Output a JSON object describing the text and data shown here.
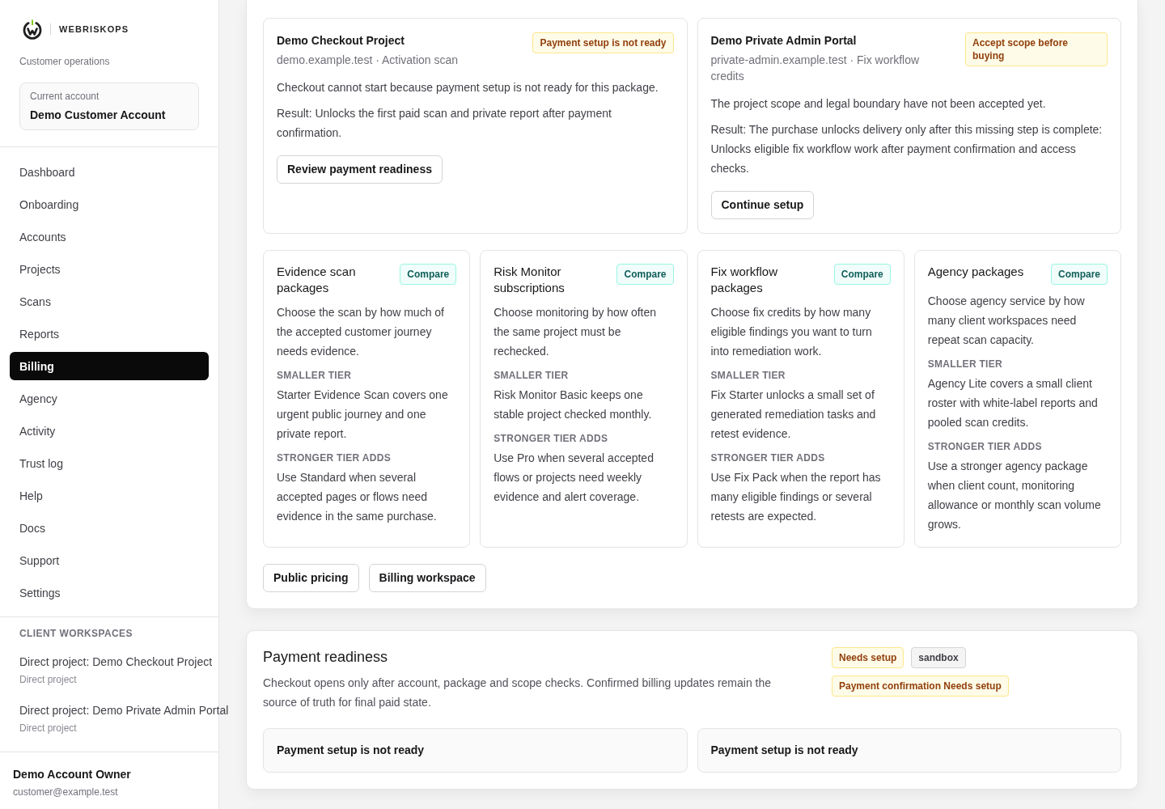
{
  "sidebar": {
    "brand": "WEBRISKOPS",
    "subtitle": "Customer operations",
    "account": {
      "label": "Current account",
      "name": "Demo Customer Account"
    },
    "nav": [
      {
        "label": "Dashboard",
        "selected": false
      },
      {
        "label": "Onboarding",
        "selected": false
      },
      {
        "label": "Accounts",
        "selected": false
      },
      {
        "label": "Projects",
        "selected": false
      },
      {
        "label": "Scans",
        "selected": false
      },
      {
        "label": "Reports",
        "selected": false
      },
      {
        "label": "Billing",
        "selected": true
      },
      {
        "label": "Agency",
        "selected": false
      },
      {
        "label": "Activity",
        "selected": false
      },
      {
        "label": "Trust log",
        "selected": false
      },
      {
        "label": "Help",
        "selected": false
      },
      {
        "label": "Docs",
        "selected": false
      },
      {
        "label": "Support",
        "selected": false
      },
      {
        "label": "Settings",
        "selected": false
      }
    ],
    "workspaces": {
      "heading": "CLIENT WORKSPACES",
      "items": [
        {
          "title": "Direct project: Demo Checkout Project",
          "subtitle": "Direct project"
        },
        {
          "title": "Direct project: Demo Private Admin Portal",
          "subtitle": "Direct project"
        }
      ]
    },
    "user": {
      "name": "Demo Account Owner",
      "email": "customer@example.test"
    }
  },
  "project_purchases": {
    "projects": [
      {
        "title": "Demo Checkout Project",
        "badge": {
          "label": "Payment setup is not ready",
          "kind": "warning"
        },
        "meta": "demo.example.test · Activation scan",
        "description": "Checkout cannot start because payment setup is not ready for this package.",
        "result": "Result: Unlocks the first paid scan and private report after payment confirmation.",
        "button": "Review payment readiness"
      },
      {
        "title": "Demo Private Admin Portal",
        "badge": {
          "label": "Accept scope before buying",
          "kind": "warning"
        },
        "meta": "private-admin.example.test · Fix workflow credits",
        "description": "The project scope and legal boundary have not been accepted yet.",
        "result": "Result: The purchase unlocks delivery only after this missing step is complete: Unlocks eligible fix workflow work after payment confirmation and access checks.",
        "button": "Continue setup"
      }
    ],
    "packages": [
      {
        "title": "Evidence scan packages",
        "badge": {
          "label": "Compare",
          "kind": "accent"
        },
        "description": "Choose the scan by how much of the accepted customer journey needs evidence.",
        "tiers": [
          {
            "label": "SMALLER TIER",
            "text": "Starter Evidence Scan covers one urgent public journey and one private report."
          },
          {
            "label": "STRONGER TIER ADDS",
            "text": "Use Standard when several accepted pages or flows need evidence in the same purchase."
          }
        ]
      },
      {
        "title": "Risk Monitor subscriptions",
        "badge": {
          "label": "Compare",
          "kind": "accent"
        },
        "description": "Choose monitoring by how often the same project must be rechecked.",
        "tiers": [
          {
            "label": "SMALLER TIER",
            "text": "Risk Monitor Basic keeps one stable project checked monthly."
          },
          {
            "label": "STRONGER TIER ADDS",
            "text": "Use Pro when several accepted flows or projects need weekly evidence and alert coverage."
          }
        ]
      },
      {
        "title": "Fix workflow packages",
        "badge": {
          "label": "Compare",
          "kind": "accent"
        },
        "description": "Choose fix credits by how many eligible findings you want to turn into remediation work.",
        "tiers": [
          {
            "label": "SMALLER TIER",
            "text": "Fix Starter unlocks a small set of generated remediation tasks and retest evidence."
          },
          {
            "label": "STRONGER TIER ADDS",
            "text": "Use Fix Pack when the report has many eligible findings or several retests are expected."
          }
        ]
      },
      {
        "title": "Agency packages",
        "badge": {
          "label": "Compare",
          "kind": "accent"
        },
        "description": "Choose agency service by how many client workspaces need repeat scan capacity.",
        "tiers": [
          {
            "label": "SMALLER TIER",
            "text": "Agency Lite covers a small client roster with white-label reports and pooled scan credits."
          },
          {
            "label": "STRONGER TIER ADDS",
            "text": "Use a stronger agency package when client count, monitoring allowance or monthly scan volume grows."
          }
        ]
      }
    ],
    "buttons": [
      "Public pricing",
      "Billing workspace"
    ]
  },
  "payment_readiness": {
    "title": "Payment readiness",
    "description": "Checkout opens only after account, package and scope checks. Confirmed billing updates remain the source of truth for final paid state.",
    "badges": [
      {
        "label": "Needs setup",
        "kind": "warning"
      },
      {
        "label": "sandbox",
        "kind": "neutral"
      },
      {
        "label": "Payment confirmation Needs setup",
        "kind": "warning"
      }
    ],
    "statuses": [
      "Payment setup is not ready",
      "Payment setup is not ready"
    ]
  }
}
